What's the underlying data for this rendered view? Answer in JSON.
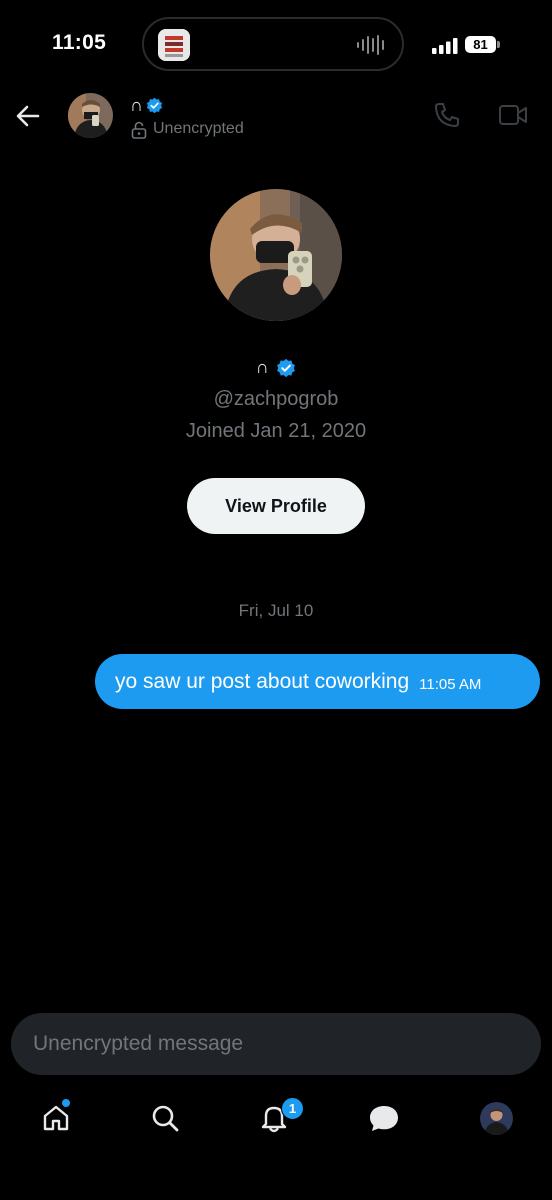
{
  "status_bar": {
    "time": "11:05",
    "battery": "81",
    "icons": [
      "signal-icon",
      "battery-icon",
      "audio-wave-icon"
    ]
  },
  "header": {
    "name": "∩",
    "verified": true,
    "encryption_status": "Unencrypted",
    "icons": [
      "back-arrow-icon",
      "verified-badge-icon",
      "lock-open-icon",
      "phone-icon",
      "video-camera-icon"
    ]
  },
  "profile": {
    "name": "∩",
    "handle": "@zachpogrob",
    "joined": "Joined Jan 21, 2020",
    "view_profile_label": "View Profile"
  },
  "conversation": {
    "date_separator": "Fri, Jul 10",
    "messages": [
      {
        "text": "yo saw ur post about coworking",
        "time": "11:05 AM",
        "direction": "outgoing"
      }
    ]
  },
  "composer": {
    "placeholder": "Unencrypted message"
  },
  "tab_bar": {
    "items": [
      "home-icon",
      "search-icon",
      "bell-icon",
      "messages-icon",
      "profile-avatar"
    ],
    "notification_count": "1",
    "home_has_unread_dot": true
  },
  "colors": {
    "background": "#000000",
    "accent": "#1d9bf0",
    "secondary_text": "#71767b",
    "primary_text": "#e7e9ea",
    "composer_bg": "#202327",
    "button_bg": "#eff3f4"
  }
}
